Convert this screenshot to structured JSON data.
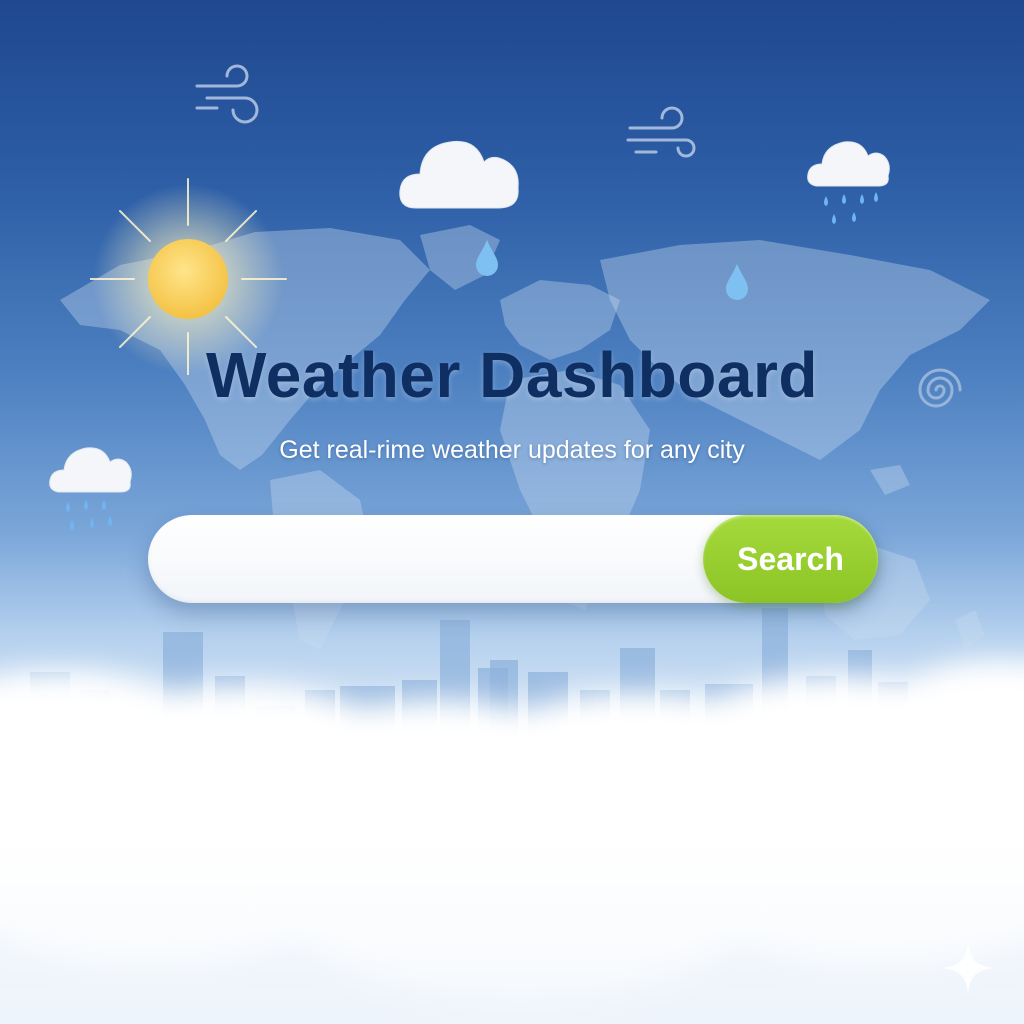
{
  "header": {
    "title": "Weather Dashboard",
    "subtitle": "Get real-rime weather updates for any city"
  },
  "search": {
    "placeholder": "",
    "value": "",
    "button_label": "Search"
  },
  "colors": {
    "title": "#0f2f63",
    "button": "#8cc425",
    "sky_top": "#1f4890",
    "sky_bottom": "#eef4fb"
  },
  "icons": [
    "sun-icon",
    "cloud-icon",
    "rain-cloud-icon",
    "raindrop-icon",
    "wind-icon",
    "spiral-icon",
    "sparkle-icon",
    "world-map",
    "city-skyline"
  ]
}
